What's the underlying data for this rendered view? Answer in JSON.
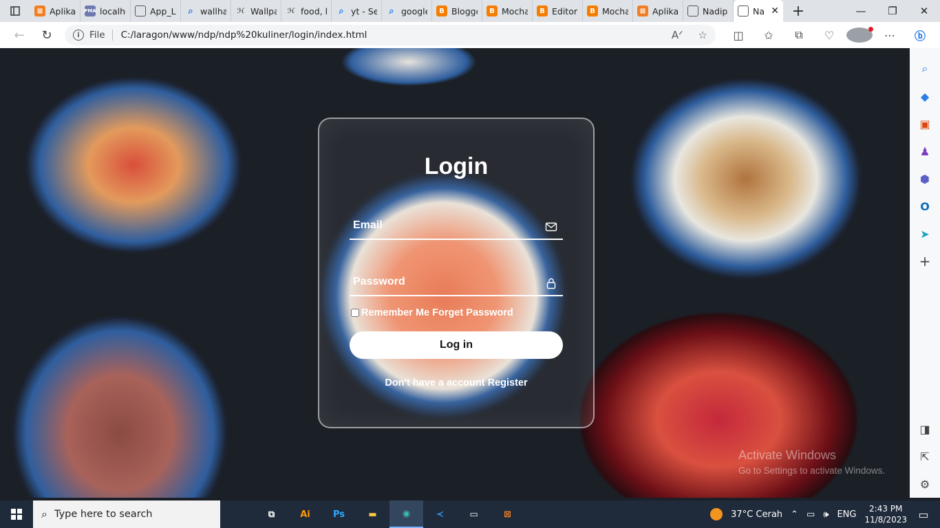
{
  "browser": {
    "tabs": [
      {
        "label": "Aplikas",
        "icon": "xampp-icon",
        "color": "#f07f24"
      },
      {
        "label": "localhc",
        "icon": "pma-icon",
        "color": "#6c78af"
      },
      {
        "label": "App_Lo",
        "icon": "page-icon",
        "color": "#777777"
      },
      {
        "label": "wallhav",
        "icon": "search-icon",
        "color": "#2b7de9"
      },
      {
        "label": "Wallpa",
        "icon": "hexo-icon",
        "color": "#777777"
      },
      {
        "label": "food, k",
        "icon": "hexo-icon",
        "color": "#777777"
      },
      {
        "label": "yt - Sea",
        "icon": "search-icon",
        "color": "#2b7de9"
      },
      {
        "label": "google",
        "icon": "search-icon",
        "color": "#2b7de9"
      },
      {
        "label": "Blogge",
        "icon": "blogger-icon",
        "color": "#f57d00"
      },
      {
        "label": "Mocha",
        "icon": "blogger-icon",
        "color": "#f57d00"
      },
      {
        "label": "Editor",
        "icon": "blogger-icon",
        "color": "#f57d00"
      },
      {
        "label": "Mocha",
        "icon": "blogger-icon",
        "color": "#f57d00"
      },
      {
        "label": "Aplikas",
        "icon": "xampp-icon",
        "color": "#f07f24"
      },
      {
        "label": "Nadip",
        "icon": "page-icon",
        "color": "#777777"
      }
    ],
    "active_tab": {
      "label": "Na",
      "icon": "page-icon"
    },
    "address": {
      "file_label": "File",
      "url": "C:/laragon/www/ndp/ndp%20kuliner/login/index.html"
    }
  },
  "login": {
    "title": "Login",
    "email_placeholder": "Email",
    "password_placeholder": "Password",
    "remember_text": "Remember Me Forget Password",
    "login_button": "Log in",
    "register_prompt": "Don't have a account",
    "register_link": "Register"
  },
  "watermark": {
    "line1": "Activate Windows",
    "line2": "Go to Settings to activate Windows."
  },
  "taskbar": {
    "search_placeholder": "Type here to search",
    "weather": "37°C  Cerah",
    "language": "ENG",
    "time": "2:43 PM",
    "date": "11/8/2023"
  },
  "colors": {
    "accent": "#ffffff",
    "taskbar": "#1f2a3a",
    "tabstrip": "#dfe3e8"
  }
}
